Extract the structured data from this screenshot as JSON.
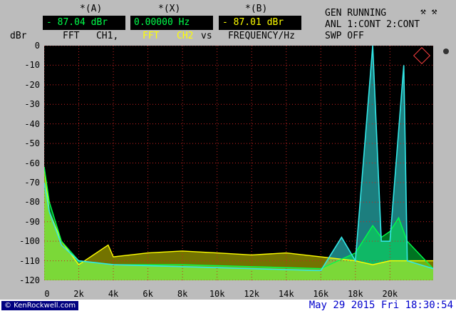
{
  "header": {
    "cursor_a": {
      "label": "*(A)",
      "value": "- 87.04 dBr"
    },
    "cursor_x": {
      "label": "*(X)",
      "value": "0.00000 Hz"
    },
    "cursor_b": {
      "label": "*(B)",
      "value": "- 87.01 dBr"
    },
    "status_line1": "GEN RUNNING",
    "status_line2": "ANL 1:CONT 2:CONT",
    "status_line3": "SWP OFF",
    "status_icons": "⚒ ⚒",
    "sub_left": "FFT   CH1,",
    "sub_mid_fft": "FFT",
    "sub_mid_ch2": "CH2",
    "sub_vs": "vs",
    "sub_right": "FREQUENCY/Hz",
    "y_unit": "dBr"
  },
  "chart_data": {
    "type": "line",
    "xlabel": "FREQUENCY/Hz",
    "ylabel": "dBr",
    "xlim": [
      0,
      22500
    ],
    "ylim": [
      -120,
      0
    ],
    "y_ticks": [
      "0",
      "-10",
      "-20",
      "-30",
      "-40",
      "-50",
      "-60",
      "-70",
      "-80",
      "-90",
      "-100",
      "-110",
      "-120"
    ],
    "x_ticks": [
      "0",
      "2k",
      "4k",
      "6k",
      "8k",
      "10k",
      "12k",
      "14k",
      "16k",
      "18k",
      "20k"
    ],
    "grid": true,
    "series": [
      {
        "color": "#ffff00",
        "x": [
          0,
          300,
          1000,
          2000,
          3700,
          4000,
          6000,
          8000,
          10000,
          12000,
          14000,
          16000,
          18000,
          19000,
          20000,
          21000,
          22500
        ],
        "y": [
          -62,
          -85,
          -100,
          -112,
          -102,
          -108,
          -106,
          -105,
          -106,
          -107,
          -106,
          -108,
          -110,
          -112,
          -110,
          -110,
          -110
        ]
      },
      {
        "color": "#00ff4a",
        "x": [
          0,
          300,
          1000,
          2000,
          4000,
          8000,
          12000,
          16000,
          18000,
          19000,
          19500,
          20000,
          20500,
          21000,
          22500
        ],
        "y": [
          -62,
          -80,
          -100,
          -110,
          -112,
          -112,
          -113,
          -114,
          -106,
          -92,
          -98,
          -95,
          -88,
          -100,
          -114
        ]
      },
      {
        "color": "#33e6e6",
        "x": [
          0,
          300,
          1000,
          2000,
          4000,
          8000,
          12000,
          16000,
          17200,
          18000,
          19000,
          19500,
          20000,
          20800,
          21000,
          22500
        ],
        "y": [
          -70,
          -85,
          -102,
          -110,
          -112,
          -113,
          -114,
          -115,
          -98,
          -110,
          0,
          -100,
          -100,
          -10,
          -110,
          -114
        ]
      }
    ]
  },
  "footer": {
    "copyright": "© KenRockwell.com",
    "datetime": "May 29 2015 Fri 18:30:54"
  },
  "colors": {
    "accent_green": "#00ff4a",
    "accent_yellow": "#ffff00",
    "trace_cyan": "#33e6e6",
    "logo_red": "#ff4040"
  }
}
